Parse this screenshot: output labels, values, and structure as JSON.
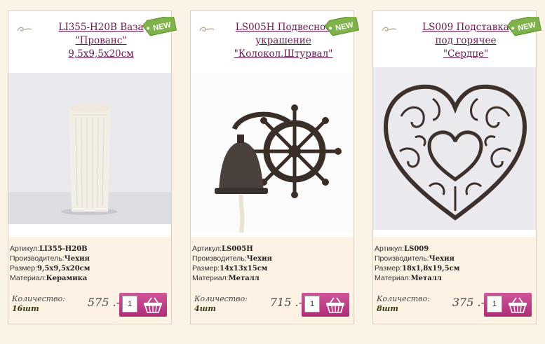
{
  "products": [
    {
      "title_line1": "LI355-H20B Ваза",
      "title_line2": "\"Прованс\"",
      "title_line3": "9,5x9,5x20см",
      "badge": "NEW",
      "article_label": "Артикул:",
      "article": "LI355-H20B",
      "maker_label": "Производитель:",
      "maker": "Чехия",
      "size_label": "Размер:",
      "size": "9,5x9,5x20см",
      "material_label": "Материал:",
      "material": "Керамика",
      "qty_label": "Количество:",
      "qty_value": "16шт",
      "price": "575 .-",
      "qty_input": "1"
    },
    {
      "title_line1": "LS005H Подвесное",
      "title_line2": "украшение",
      "title_line3": "\"Колокол.Штурвал\"",
      "badge": "NEW",
      "article_label": "Артикул:",
      "article": "LS005H",
      "maker_label": "Производитель:",
      "maker": "Чехия",
      "size_label": "Размер:",
      "size": "14x13x15см",
      "material_label": "Материал:",
      "material": "Металл",
      "qty_label": "Количество:",
      "qty_value": "4шт",
      "price": "715 .-",
      "qty_input": "1"
    },
    {
      "title_line1": "LS009 Подставка",
      "title_line2": "под горячее",
      "title_line3": "\"Сердце\"",
      "badge": "NEW",
      "article_label": "Артикул:",
      "article": "LS009",
      "maker_label": "Производитель:",
      "maker": "Чехия",
      "size_label": "Размер:",
      "size": "18x1,8x19,5см",
      "material_label": "Материал:",
      "material": "Металл",
      "qty_label": "Количество:",
      "qty_value": "8шт",
      "price": "375 .-",
      "qty_input": "1"
    }
  ],
  "icons": {
    "swirl": "swirl-ornament-icon",
    "badge": "new-tag-icon",
    "cart": "shopping-basket-icon"
  },
  "colors": {
    "title": "#6b1a4f",
    "badge": "#7fb24a",
    "button": "#c03f88",
    "info_bg": "#fdf2e4"
  }
}
